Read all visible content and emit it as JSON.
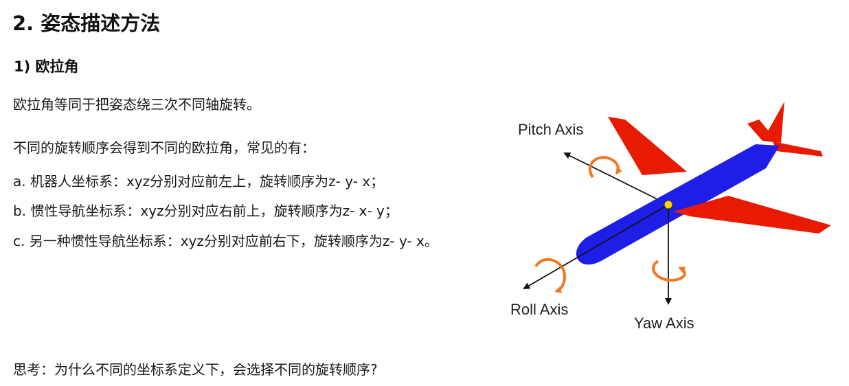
{
  "title": "2. 姿态描述方法",
  "subtitle": "1) 欧拉角",
  "intro": "欧拉角等同于把姿态绕三次不同轴旋转。",
  "orders_intro": "不同的旋转顺序会得到不同的欧拉角，常见的有：",
  "items": [
    "a. 机器人坐标系：xyz分别对应前左上，旋转顺序为z- y- x；",
    "b. 惯性导航坐标系：xyz分别对应右前上，旋转顺序为z- x- y；",
    "c. 另一种惯性导航坐标系：xyz分别对应前右下，旋转顺序为z- y- x。"
  ],
  "question": "思考：为什么不同的坐标系定义下，会选择不同的旋转顺序?",
  "diagram": {
    "pitch_label": "Pitch Axis",
    "roll_label": "Roll Axis",
    "yaw_label": "Yaw Axis",
    "colors": {
      "fuselage": "#1e1ee6",
      "wings": "#e81a00",
      "rotation_arrows": "#f07820",
      "axes": "#111111",
      "center": "#ffd000"
    }
  }
}
